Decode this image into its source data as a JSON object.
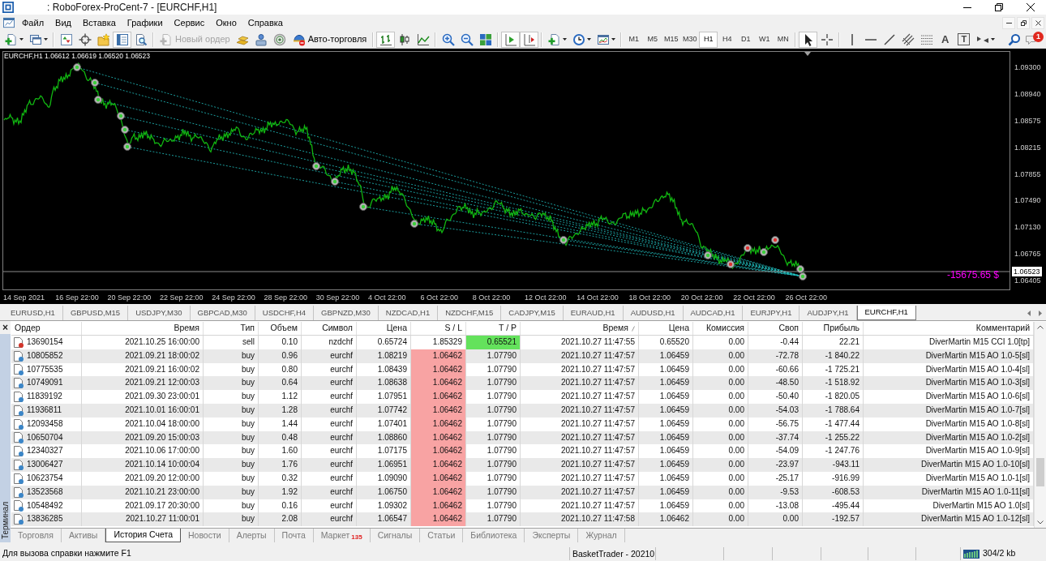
{
  "window": {
    "title": ": RoboForex-ProCent-7 - [EURCHF,H1]"
  },
  "menu": [
    "Файл",
    "Вид",
    "Вставка",
    "Графики",
    "Сервис",
    "Окно",
    "Справка"
  ],
  "toolbar": [
    [
      {
        "kind": "icon",
        "pressed": false,
        "dropdown": true
      },
      {
        "kind": "icon",
        "pressed": false,
        "dropdown": true
      }
    ],
    [
      {
        "kind": "icon",
        "pressed": false
      },
      {
        "kind": "icon",
        "pressed": false
      },
      {
        "kind": "icon",
        "pressed": false
      },
      {
        "kind": "icon",
        "pressed": true
      },
      {
        "kind": "icon",
        "pressed": false
      }
    ],
    [
      {
        "kind": "text",
        "label": "Новый ордер",
        "disabled": true,
        "pressed": false
      },
      {
        "kind": "icon",
        "pressed": false
      },
      {
        "kind": "icon",
        "pressed": false
      },
      {
        "kind": "icon",
        "pressed": false
      },
      {
        "kind": "text",
        "label": "Авто-торговля",
        "disabled": false,
        "pressed": false
      }
    ],
    [
      {
        "kind": "icon",
        "pressed": true
      },
      {
        "kind": "icon",
        "pressed": false
      },
      {
        "kind": "icon",
        "pressed": false
      }
    ],
    [
      {
        "kind": "icon",
        "pressed": false
      },
      {
        "kind": "icon",
        "pressed": false
      },
      {
        "kind": "icon",
        "pressed": false
      }
    ],
    [
      {
        "kind": "icon",
        "pressed": true
      },
      {
        "kind": "icon",
        "pressed": true
      }
    ],
    [
      {
        "kind": "icon",
        "pressed": false,
        "dropdown": true
      },
      {
        "kind": "icon",
        "pressed": false,
        "dropdown": true
      },
      {
        "kind": "icon",
        "pressed": false,
        "dropdown": true
      }
    ],
    [
      {
        "kind": "period",
        "label": "M1",
        "selected": false
      },
      {
        "kind": "period",
        "label": "M5",
        "selected": false
      },
      {
        "kind": "period",
        "label": "M15",
        "selected": false
      },
      {
        "kind": "period",
        "label": "M30",
        "selected": false
      },
      {
        "kind": "period",
        "label": "H1",
        "selected": true
      },
      {
        "kind": "period",
        "label": "H4",
        "selected": false
      },
      {
        "kind": "period",
        "label": "D1",
        "selected": false
      },
      {
        "kind": "period",
        "label": "W1",
        "selected": false
      },
      {
        "kind": "period",
        "label": "MN",
        "selected": false
      }
    ],
    [
      {
        "kind": "icon",
        "pressed": true
      },
      {
        "kind": "icon",
        "pressed": false
      }
    ],
    [
      {
        "kind": "icon",
        "pressed": false
      },
      {
        "kind": "icon",
        "pressed": false
      },
      {
        "kind": "icon",
        "pressed": false
      },
      {
        "kind": "icon",
        "pressed": false
      },
      {
        "kind": "icon",
        "pressed": false
      },
      {
        "kind": "glyph",
        "label": "A",
        "framed": false,
        "pressed": false
      },
      {
        "kind": "glyph",
        "label": "T",
        "framed": true,
        "pressed": false
      },
      {
        "kind": "icon",
        "pressed": false,
        "dropdown": true
      }
    ]
  ],
  "toolbar_end": {
    "badge": "1"
  },
  "chart": {
    "title": "EURCHF,H1 1.06612 1.06619 1.06520 1.06523",
    "price_labels": [
      "1.09300",
      "1.08940",
      "1.08575",
      "1.08215",
      "1.07855",
      "1.07490",
      "1.07130",
      "1.06765",
      "1.06405"
    ],
    "current_price": "1.06523",
    "profit": "-15675.65 $",
    "time_labels": [
      "14 Sep 2021",
      "16 Sep 22:00",
      "20 Sep 22:00",
      "22 Sep 22:00",
      "24 Sep 22:00",
      "28 Sep 22:00",
      "30 Sep 22:00",
      "4 Oct 22:00",
      "6 Oct 22:00",
      "8 Oct 22:00",
      "12 Oct 22:00",
      "14 Oct 22:00",
      "18 Oct 22:00",
      "20 Oct 22:00",
      "22 Oct 22:00",
      "26 Oct 22:00"
    ]
  },
  "chart_tabs": [
    {
      "label": "EURUSD,H1",
      "selected": false
    },
    {
      "label": "GBPUSD,M15",
      "selected": false
    },
    {
      "label": "USDJPY,M30",
      "selected": false
    },
    {
      "label": "GBPCAD,M30",
      "selected": false
    },
    {
      "label": "USDCHF,H4",
      "selected": false
    },
    {
      "label": "GBPNZD,M30",
      "selected": false
    },
    {
      "label": "NZDCAD,H1",
      "selected": false
    },
    {
      "label": "NZDCHF,M15",
      "selected": false
    },
    {
      "label": "CADJPY,M15",
      "selected": false
    },
    {
      "label": "EURAUD,H1",
      "selected": false
    },
    {
      "label": "AUDUSD,H1",
      "selected": false
    },
    {
      "label": "AUDCAD,H1",
      "selected": false
    },
    {
      "label": "EURJPY,H1",
      "selected": false
    },
    {
      "label": "AUDJPY,H1",
      "selected": false
    },
    {
      "label": "EURCHF,H1",
      "selected": true
    }
  ],
  "terminal": {
    "close": "×",
    "label": "Терминал",
    "columns": [
      {
        "label": "Ордер",
        "sorted": false
      },
      {
        "label": "Время",
        "sorted": false
      },
      {
        "label": "Тип",
        "sorted": false
      },
      {
        "label": "Объем",
        "sorted": false
      },
      {
        "label": "Символ",
        "sorted": false
      },
      {
        "label": "Цена",
        "sorted": false
      },
      {
        "label": "S / L",
        "sorted": false
      },
      {
        "label": "T / P",
        "sorted": false
      },
      {
        "label": "Время",
        "sorted": true
      },
      {
        "label": "Цена",
        "sorted": false
      },
      {
        "label": "Комиссия",
        "sorted": false
      },
      {
        "label": "Своп",
        "sorted": false
      },
      {
        "label": "Прибыль",
        "sorted": false
      },
      {
        "label": "Комментарий",
        "sorted": false
      }
    ],
    "rows": [
      {
        "cells": [
          "13690154",
          "2021.10.25 16:00:00",
          "sell",
          "0.10",
          "nzdchf",
          "0.65724",
          "1.85329",
          "0.65521",
          "2021.10.27 11:47:55",
          "0.65520",
          "0.00",
          "-0.44",
          "22.21",
          "DiverMartin M15 CCI 1.0[tp]"
        ],
        "sl_hit": false,
        "tp_hit": true,
        "color": "#d2352b"
      },
      {
        "cells": [
          "10805852",
          "2021.09.21 18:00:02",
          "buy",
          "0.96",
          "eurchf",
          "1.08219",
          "1.06462",
          "1.07790",
          "2021.10.27 11:47:57",
          "1.06459",
          "0.00",
          "-72.78",
          "-1 840.22",
          "DiverMartin M15 AO 1.0-5[sl]"
        ],
        "sl_hit": true,
        "tp_hit": false,
        "color": "#3b86c8"
      },
      {
        "cells": [
          "10775535",
          "2021.09.21 16:00:02",
          "buy",
          "0.80",
          "eurchf",
          "1.08439",
          "1.06462",
          "1.07790",
          "2021.10.27 11:47:57",
          "1.06459",
          "0.00",
          "-60.66",
          "-1 725.21",
          "DiverMartin M15 AO 1.0-4[sl]"
        ],
        "sl_hit": true,
        "tp_hit": false,
        "color": "#3b86c8"
      },
      {
        "cells": [
          "10749091",
          "2021.09.21 12:00:03",
          "buy",
          "0.64",
          "eurchf",
          "1.08638",
          "1.06462",
          "1.07790",
          "2021.10.27 11:47:57",
          "1.06459",
          "0.00",
          "-48.50",
          "-1 518.92",
          "DiverMartin M15 AO 1.0-3[sl]"
        ],
        "sl_hit": true,
        "tp_hit": false,
        "color": "#3b86c8"
      },
      {
        "cells": [
          "11839192",
          "2021.09.30 23:00:01",
          "buy",
          "1.12",
          "eurchf",
          "1.07951",
          "1.06462",
          "1.07790",
          "2021.10.27 11:47:57",
          "1.06459",
          "0.00",
          "-50.40",
          "-1 820.05",
          "DiverMartin M15 AO 1.0-6[sl]"
        ],
        "sl_hit": true,
        "tp_hit": false,
        "color": "#3b86c8"
      },
      {
        "cells": [
          "11936811",
          "2021.10.01 16:00:01",
          "buy",
          "1.28",
          "eurchf",
          "1.07742",
          "1.06462",
          "1.07790",
          "2021.10.27 11:47:57",
          "1.06459",
          "0.00",
          "-54.03",
          "-1 788.64",
          "DiverMartin M15 AO 1.0-7[sl]"
        ],
        "sl_hit": true,
        "tp_hit": false,
        "color": "#3b86c8"
      },
      {
        "cells": [
          "12093458",
          "2021.10.04 18:00:00",
          "buy",
          "1.44",
          "eurchf",
          "1.07401",
          "1.06462",
          "1.07790",
          "2021.10.27 11:47:57",
          "1.06459",
          "0.00",
          "-56.75",
          "-1 477.44",
          "DiverMartin M15 AO 1.0-8[sl]"
        ],
        "sl_hit": true,
        "tp_hit": false,
        "color": "#3b86c8"
      },
      {
        "cells": [
          "10650704",
          "2021.09.20 15:00:03",
          "buy",
          "0.48",
          "eurchf",
          "1.08860",
          "1.06462",
          "1.07790",
          "2021.10.27 11:47:57",
          "1.06459",
          "0.00",
          "-37.74",
          "-1 255.22",
          "DiverMartin M15 AO 1.0-2[sl]"
        ],
        "sl_hit": true,
        "tp_hit": false,
        "color": "#3b86c8"
      },
      {
        "cells": [
          "12340327",
          "2021.10.06 17:00:00",
          "buy",
          "1.60",
          "eurchf",
          "1.07175",
          "1.06462",
          "1.07790",
          "2021.10.27 11:47:57",
          "1.06459",
          "0.00",
          "-54.09",
          "-1 247.76",
          "DiverMartin M15 AO 1.0-9[sl]"
        ],
        "sl_hit": true,
        "tp_hit": false,
        "color": "#3b86c8"
      },
      {
        "cells": [
          "13006427",
          "2021.10.14 10:00:04",
          "buy",
          "1.76",
          "eurchf",
          "1.06951",
          "1.06462",
          "1.07790",
          "2021.10.27 11:47:57",
          "1.06459",
          "0.00",
          "-23.97",
          "-943.11",
          "DiverMartin M15 AO 1.0-10[sl]"
        ],
        "sl_hit": true,
        "tp_hit": false,
        "color": "#3b86c8"
      },
      {
        "cells": [
          "10623754",
          "2021.09.20 12:00:00",
          "buy",
          "0.32",
          "eurchf",
          "1.09090",
          "1.06462",
          "1.07790",
          "2021.10.27 11:47:57",
          "1.06459",
          "0.00",
          "-25.17",
          "-916.99",
          "DiverMartin M15 AO 1.0-1[sl]"
        ],
        "sl_hit": true,
        "tp_hit": false,
        "color": "#3b86c8"
      },
      {
        "cells": [
          "13523568",
          "2021.10.21 23:00:00",
          "buy",
          "1.92",
          "eurchf",
          "1.06750",
          "1.06462",
          "1.07790",
          "2021.10.27 11:47:57",
          "1.06459",
          "0.00",
          "-9.53",
          "-608.53",
          "DiverMartin M15 AO 1.0-11[sl]"
        ],
        "sl_hit": true,
        "tp_hit": false,
        "color": "#3b86c8"
      },
      {
        "cells": [
          "10548492",
          "2021.09.17 20:30:00",
          "buy",
          "0.16",
          "eurchf",
          "1.09302",
          "1.06462",
          "1.07790",
          "2021.10.27 11:47:57",
          "1.06459",
          "0.00",
          "-13.08",
          "-495.44",
          "DiverMartin M15 AO 1.0[sl]"
        ],
        "sl_hit": true,
        "tp_hit": false,
        "color": "#3b86c8"
      },
      {
        "cells": [
          "13836285",
          "2021.10.27 11:00:01",
          "buy",
          "2.08",
          "eurchf",
          "1.06547",
          "1.06462",
          "1.07790",
          "2021.10.27 11:47:58",
          "1.06462",
          "0.00",
          "0.00",
          "-192.57",
          "DiverMartin M15 AO 1.0-12[sl]"
        ],
        "sl_hit": true,
        "tp_hit": false,
        "color": "#3b86c8"
      }
    ],
    "tabs": [
      {
        "label": "Торговля",
        "selected": false
      },
      {
        "label": "Активы",
        "selected": false
      },
      {
        "label": "История Счета",
        "selected": true
      },
      {
        "label": "Новости",
        "selected": false
      },
      {
        "label": "Алерты",
        "selected": false
      },
      {
        "label": "Почта",
        "selected": false
      },
      {
        "label": "Маркет",
        "badge": "135",
        "selected": false
      },
      {
        "label": "Сигналы",
        "selected": false
      },
      {
        "label": "Статьи",
        "selected": false
      },
      {
        "label": "Библиотека",
        "selected": false
      },
      {
        "label": "Эксперты",
        "selected": false
      },
      {
        "label": "Журнал",
        "selected": false
      }
    ]
  },
  "status_bar": {
    "help": "Для вызова справки нажмите F1",
    "panes": [
      "BasketTrader - 20210"
    ],
    "traffic": "304/2 kb"
  }
}
